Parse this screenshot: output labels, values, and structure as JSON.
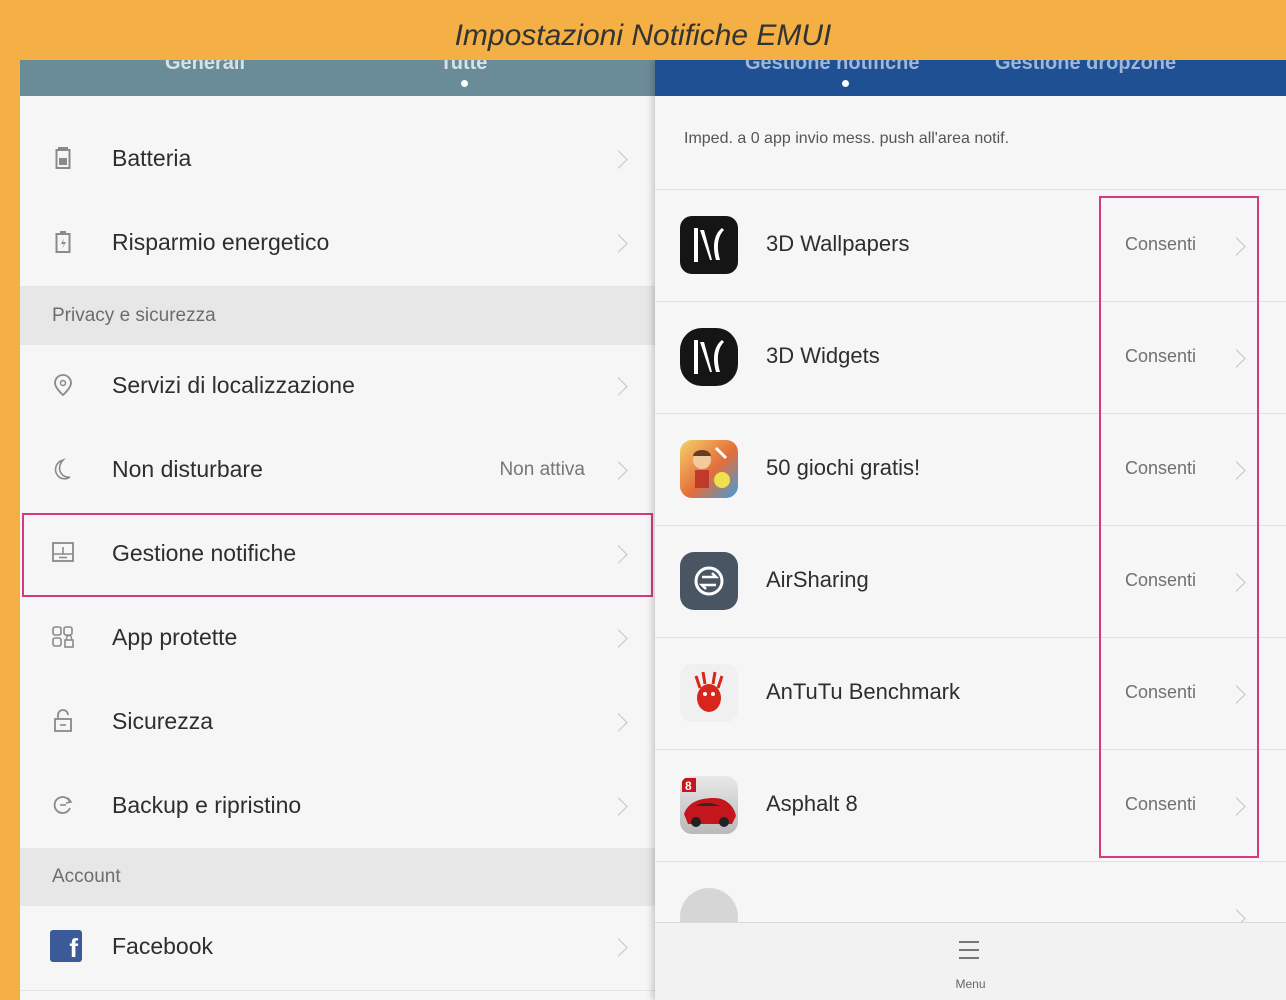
{
  "caption": "Impostazioni Notifiche EMUI",
  "left_tabs": [
    "Generali",
    "Tutte"
  ],
  "left_items_top": [
    {
      "label": "Batteria",
      "icon": "battery-icon",
      "value": ""
    },
    {
      "label": "Risparmio energetico",
      "icon": "power-saving-icon",
      "value": ""
    }
  ],
  "section_privacy": "Privacy e sicurezza",
  "left_items_privacy": [
    {
      "label": "Servizi di localizzazione",
      "icon": "location-icon",
      "value": ""
    },
    {
      "label": "Non disturbare",
      "icon": "moon-icon",
      "value": "Non attiva"
    },
    {
      "label": "Gestione notifiche",
      "icon": "notification-panel-icon",
      "value": ""
    },
    {
      "label": "App protette",
      "icon": "protected-apps-icon",
      "value": ""
    },
    {
      "label": "Sicurezza",
      "icon": "lock-icon",
      "value": ""
    },
    {
      "label": "Backup e ripristino",
      "icon": "backup-icon",
      "value": ""
    }
  ],
  "section_account": "Account",
  "left_items_account": [
    {
      "label": "Facebook",
      "icon": "facebook-icon",
      "value": ""
    }
  ],
  "right_tabs": [
    "Gestione notifiche",
    "Gestione dropzone"
  ],
  "right_note": "Imped. a 0 app invio mess. push all'area notif.",
  "apps": [
    {
      "name": "3D Wallpapers",
      "value": "Consenti",
      "icon": "3d-wallpapers-icon"
    },
    {
      "name": "3D Widgets",
      "value": "Consenti",
      "icon": "3d-widgets-icon"
    },
    {
      "name": "50 giochi gratis!",
      "value": "Consenti",
      "icon": "50-giochi-icon"
    },
    {
      "name": "AirSharing",
      "value": "Consenti",
      "icon": "airsharing-icon"
    },
    {
      "name": "AnTuTu Benchmark",
      "value": "Consenti",
      "icon": "antutu-icon"
    },
    {
      "name": "Asphalt 8",
      "value": "Consenti",
      "icon": "asphalt-icon"
    }
  ],
  "bottom_menu_label": "Menu",
  "colors": {
    "frame": "#f4b044",
    "highlight": "#d63a7d",
    "right_header": "#1e5093",
    "left_header": "#6a8c98"
  }
}
